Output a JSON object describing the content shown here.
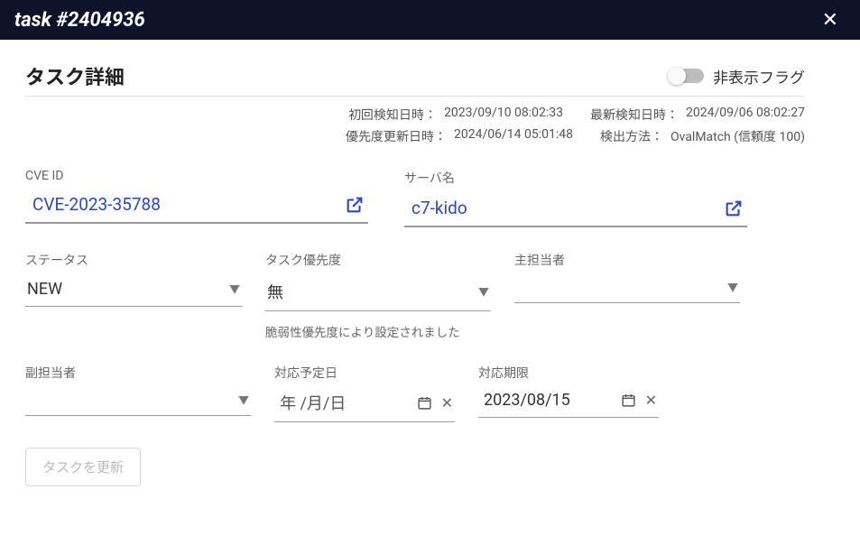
{
  "titlebar": {
    "title": "task #2404936"
  },
  "header": {
    "page_title": "タスク詳細",
    "toggle_label": "非表示フラグ"
  },
  "meta": {
    "first_detect_label": "初回検知日時：",
    "first_detect_value": "2023/09/10 08:02:33",
    "last_detect_label": "最新検知日時：",
    "last_detect_value": "2024/09/06 08:02:27",
    "prio_update_label": "優先度更新日時：",
    "prio_update_value": "2024/06/14 05:01:48",
    "method_label": "検出方法：",
    "method_value": "OvalMatch (信頼度 100)"
  },
  "fields": {
    "cve_label": "CVE ID",
    "cve_value": "CVE-2023-35788",
    "server_label": "サーバ名",
    "server_value": "c7-kido",
    "status_label": "ステータス",
    "status_value": "NEW",
    "prio_label": "タスク優先度",
    "prio_value": "無",
    "prio_helper": "脆弱性優先度により設定されました",
    "owner_label": "主担当者",
    "owner_value": "",
    "subowner_label": "副担当者",
    "subowner_value": "",
    "planned_label": "対応予定日",
    "planned_value": "年 /月/日",
    "deadline_label": "対応期限",
    "deadline_value": "2023/08/15"
  },
  "buttons": {
    "update": "タスクを更新"
  }
}
